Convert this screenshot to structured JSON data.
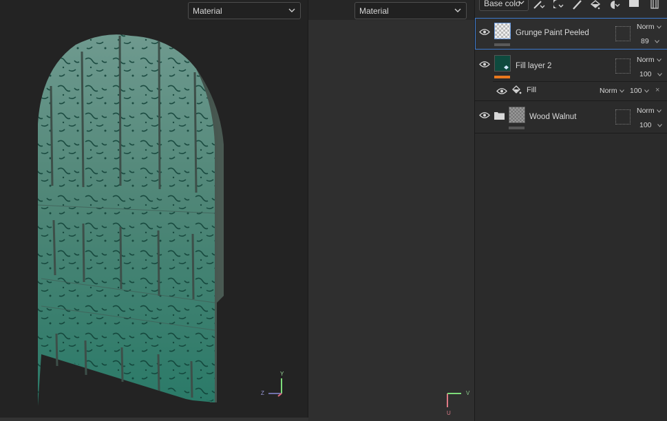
{
  "viewport3d": {
    "channel_dropdown": "Material",
    "axis_labels": {
      "y": "Y",
      "z": "Z"
    }
  },
  "viewport2d": {
    "channel_dropdown": "Material",
    "axis_labels": {
      "u": "U",
      "v": "V"
    }
  },
  "layers_panel": {
    "channel_select": "Base colo",
    "toolbar_icons": [
      "add-effect-icon",
      "add-mask-icon",
      "add-paint-layer-icon",
      "add-fill-layer-icon",
      "add-smart-material-icon",
      "add-folder-icon",
      "delete-layer-icon"
    ],
    "layers": [
      {
        "name": "Grunge Paint Peeled",
        "blend_mode": "Norm",
        "opacity": "89",
        "selected": true,
        "thumbnail": "checker",
        "bar_color": "#5a5a5a"
      },
      {
        "name": "Fill layer 2",
        "blend_mode": "Norm",
        "opacity": "100",
        "selected": false,
        "thumbnail": "fill",
        "thumbnail_color": "#0e4a3e",
        "bar_color": "#e8781e",
        "effects": [
          {
            "name": "Fill",
            "blend_mode": "Norm",
            "opacity": "100"
          }
        ]
      },
      {
        "name": "Wood Walnut",
        "blend_mode": "Norm",
        "opacity": "100",
        "selected": false,
        "is_folder": true,
        "thumbnail": "checker-grey",
        "bar_color": "#555555"
      }
    ]
  },
  "colors": {
    "selection_accent": "#3d7bd0",
    "mesh_paint": "#2f7a6a",
    "axis_x": "#e06a7a",
    "axis_y": "#7ddc7a",
    "axis_z": "#8a8ad8"
  }
}
